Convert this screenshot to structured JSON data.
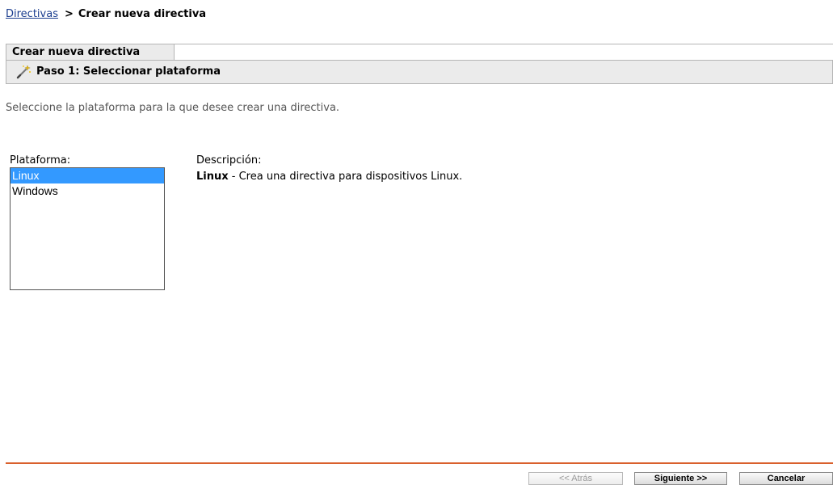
{
  "breadcrumb": {
    "link": "Directivas",
    "separator": ">",
    "current": "Crear nueva directiva"
  },
  "wizard": {
    "tab_title": "Crear nueva directiva",
    "step_icon": "wand-icon",
    "step_title": "Paso 1: Seleccionar plataforma",
    "instructions": "Seleccione la plataforma para la que desee crear una directiva."
  },
  "platform": {
    "label": "Plataforma:",
    "options": [
      "Linux",
      "Windows"
    ],
    "selected": "Linux"
  },
  "description": {
    "label": "Descripción:",
    "name": "Linux",
    "text": " - Crea una directiva para dispositivos Linux."
  },
  "buttons": {
    "back": "<< Atrás",
    "next": "Siguiente >>",
    "cancel": "Cancelar"
  },
  "colors": {
    "selection": "#3399ff",
    "footer_line": "#d9602c",
    "link": "#1a3d8f"
  }
}
